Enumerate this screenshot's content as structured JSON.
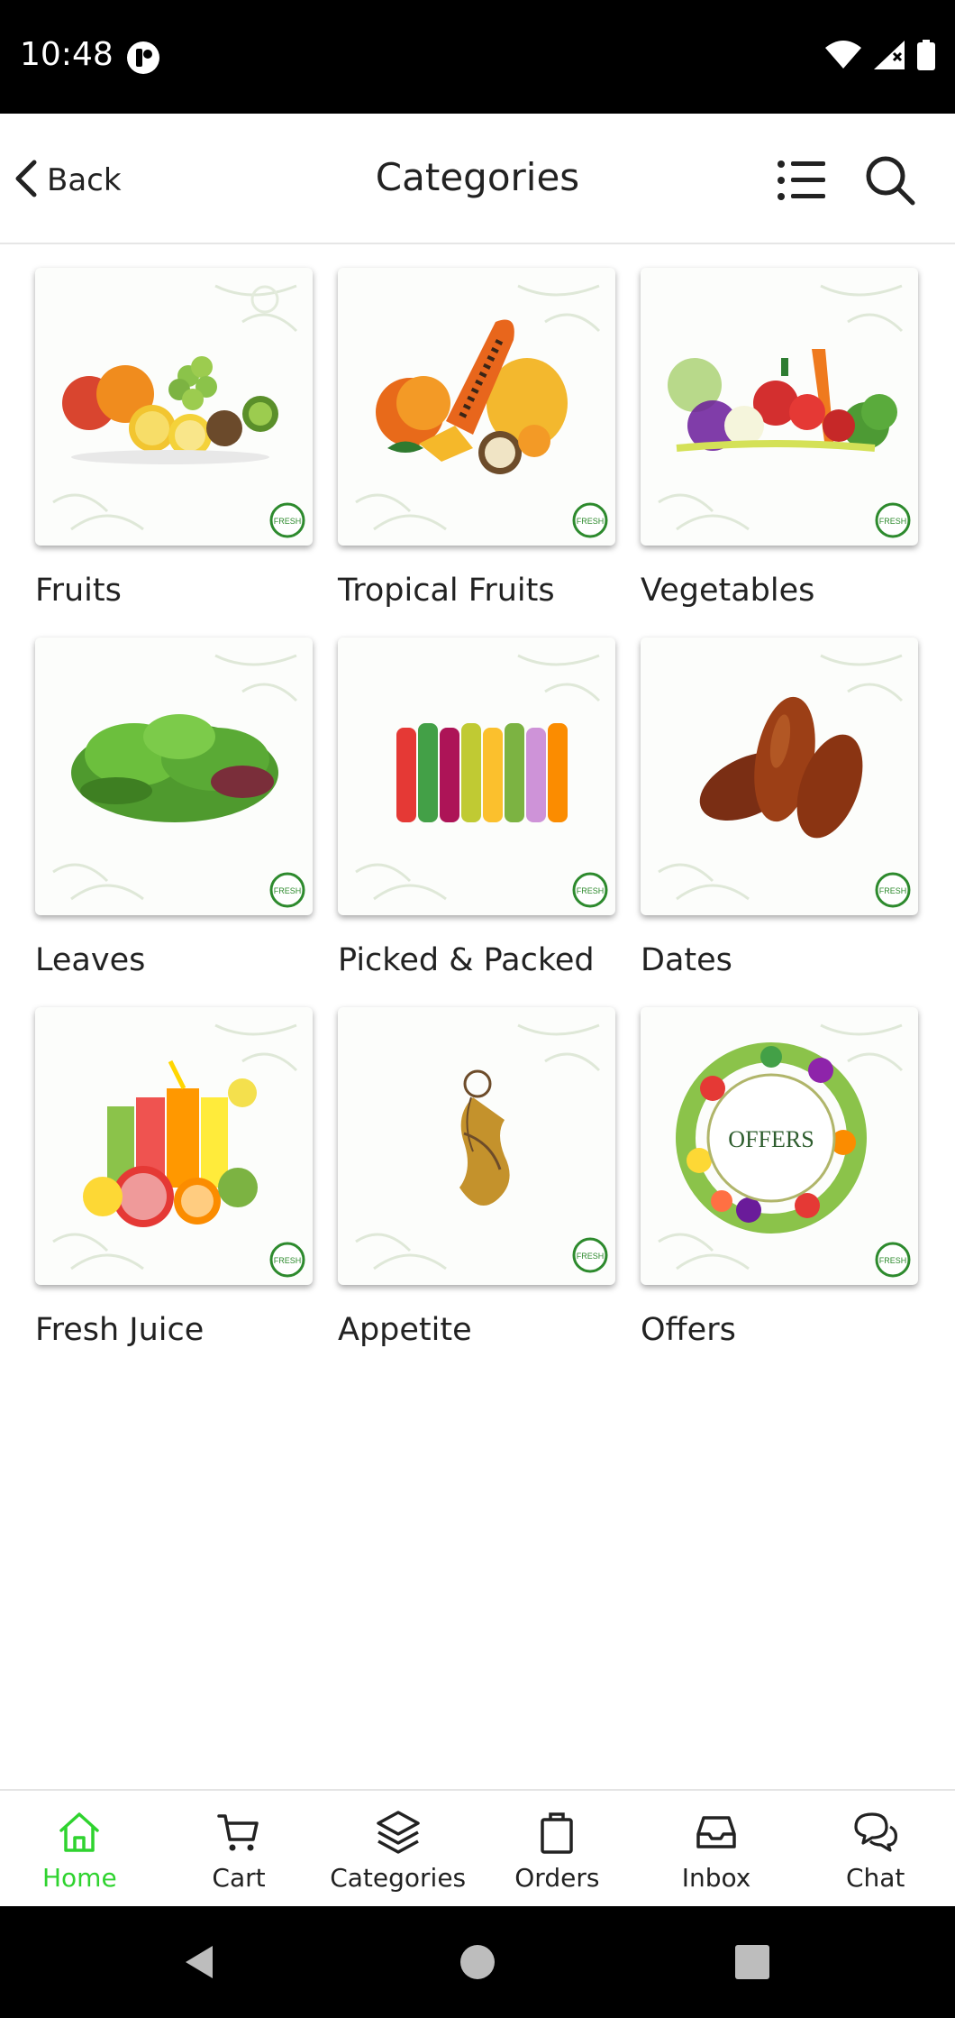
{
  "status_bar": {
    "time": "10:48"
  },
  "app_bar": {
    "back_label": "Back",
    "title": "Categories"
  },
  "categories": [
    {
      "label": "Fruits",
      "image": "fruits-image"
    },
    {
      "label": "Tropical Fruits",
      "image": "tropical-fruits-image"
    },
    {
      "label": "Vegetables",
      "image": "vegetables-image"
    },
    {
      "label": "Leaves",
      "image": "leaves-image"
    },
    {
      "label": "Picked & Packed",
      "image": "picked-packed-image"
    },
    {
      "label": "Dates",
      "image": "dates-image"
    },
    {
      "label": "Fresh Juice",
      "image": "fresh-juice-image"
    },
    {
      "label": "Appetite",
      "image": "appetite-image"
    },
    {
      "label": "Offers",
      "image": "offers-image",
      "badge_text": "OFFERS"
    }
  ],
  "fresh_badge": "FRESH",
  "bottom_nav": [
    {
      "label": "Home",
      "icon": "home-icon",
      "active": true
    },
    {
      "label": "Cart",
      "icon": "cart-icon",
      "active": false
    },
    {
      "label": "Categories",
      "icon": "layers-icon",
      "active": false
    },
    {
      "label": "Orders",
      "icon": "bag-icon",
      "active": false
    },
    {
      "label": "Inbox",
      "icon": "inbox-icon",
      "active": false
    },
    {
      "label": "Chat",
      "icon": "chat-icon",
      "active": false
    }
  ],
  "colors": {
    "active": "#2fd32f",
    "text": "#222222",
    "status_bar": "#000000"
  }
}
